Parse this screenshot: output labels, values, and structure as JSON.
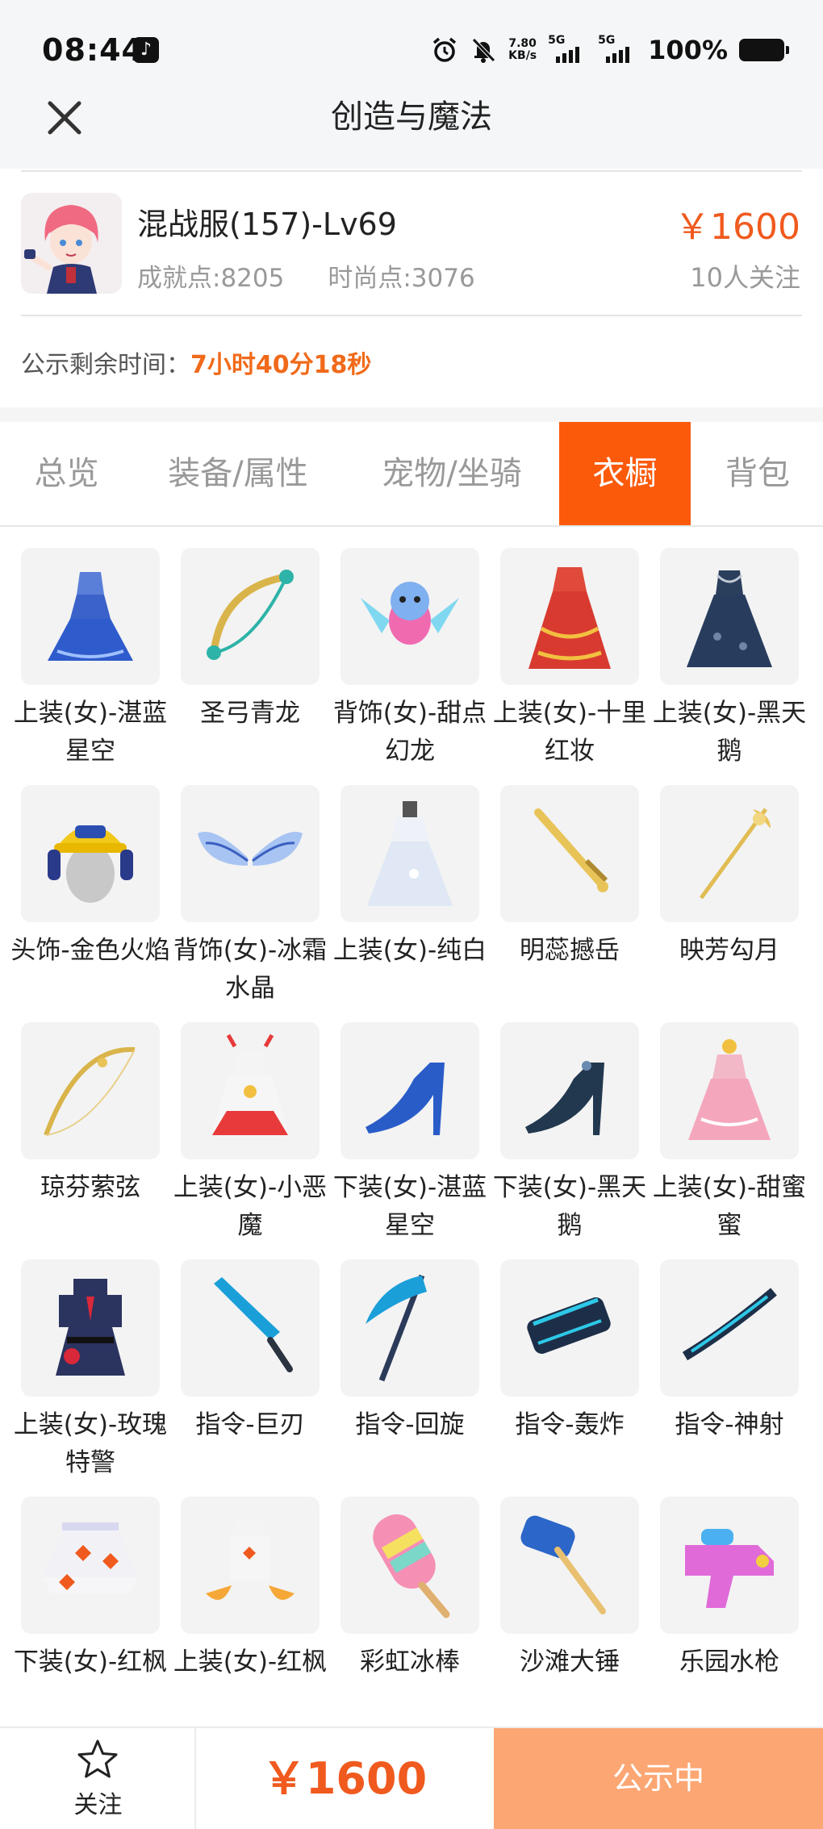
{
  "status_bar": {
    "time": "08:44",
    "network_speed": "7.80",
    "network_unit": "KB/s",
    "sim1": "5G",
    "sim2": "5G",
    "battery": "100%"
  },
  "header": {
    "title": "创造与魔法"
  },
  "product": {
    "name": "混战服(157)-Lv69",
    "achievement": "成就点:8205",
    "fashion": "时尚点:3076",
    "price": "￥1600",
    "followers": "10人关注",
    "countdown_label": "公示剩余时间：",
    "countdown_value": "7小时40分18秒"
  },
  "tabs": [
    {
      "label": "总览"
    },
    {
      "label": "装备/属性"
    },
    {
      "label": "宠物/坐骑"
    },
    {
      "label": "衣橱"
    },
    {
      "label": "背包"
    }
  ],
  "active_tab": "衣橱",
  "items": [
    {
      "label": "上装(女)-湛蓝星空",
      "icon": "blue-dress-icon"
    },
    {
      "label": "圣弓青龙",
      "icon": "dragon-bow-icon"
    },
    {
      "label": "背饰(女)-甜点幻龙",
      "icon": "dragon-pet-icon"
    },
    {
      "label": "上装(女)-十里红妆",
      "icon": "red-gown-icon"
    },
    {
      "label": "上装(女)-黑天鹅",
      "icon": "dark-dress-icon"
    },
    {
      "label": "头饰-金色火焰",
      "icon": "helmet-icon"
    },
    {
      "label": "背饰(女)-冰霜水晶",
      "icon": "ice-wings-icon"
    },
    {
      "label": "上装(女)-纯白",
      "icon": "white-dress-icon"
    },
    {
      "label": "明蕊撼岳",
      "icon": "golden-sword-icon"
    },
    {
      "label": "映芳勾月",
      "icon": "golden-spear-icon"
    },
    {
      "label": "琼芬萦弦",
      "icon": "golden-bow-icon"
    },
    {
      "label": "上装(女)-小恶魔",
      "icon": "demon-outfit-icon"
    },
    {
      "label": "下装(女)-湛蓝星空",
      "icon": "blue-heels-icon"
    },
    {
      "label": "下装(女)-黑天鹅",
      "icon": "dark-heels-icon"
    },
    {
      "label": "上装(女)-甜蜜蜜",
      "icon": "pink-dress-icon"
    },
    {
      "label": "上装(女)-玫瑰特警",
      "icon": "police-outfit-icon"
    },
    {
      "label": "指令-巨刃",
      "icon": "great-blade-icon"
    },
    {
      "label": "指令-回旋",
      "icon": "scythe-icon"
    },
    {
      "label": "指令-轰炸",
      "icon": "cannon-icon"
    },
    {
      "label": "指令-神射",
      "icon": "crossbow-icon"
    },
    {
      "label": "下装(女)-红枫",
      "icon": "maple-skirt-icon"
    },
    {
      "label": "上装(女)-红枫",
      "icon": "maple-top-icon"
    },
    {
      "label": "彩虹冰棒",
      "icon": "rainbow-popsicle-icon"
    },
    {
      "label": "沙滩大锤",
      "icon": "beach-hammer-icon"
    },
    {
      "label": "乐园水枪",
      "icon": "water-gun-icon"
    }
  ],
  "bottom_bar": {
    "follow_label": "关注",
    "price": "￥1600",
    "status_label": "公示中"
  },
  "colors": {
    "accent": "#fb5a0a",
    "price": "#f05a1e",
    "status_button": "#fca673"
  }
}
